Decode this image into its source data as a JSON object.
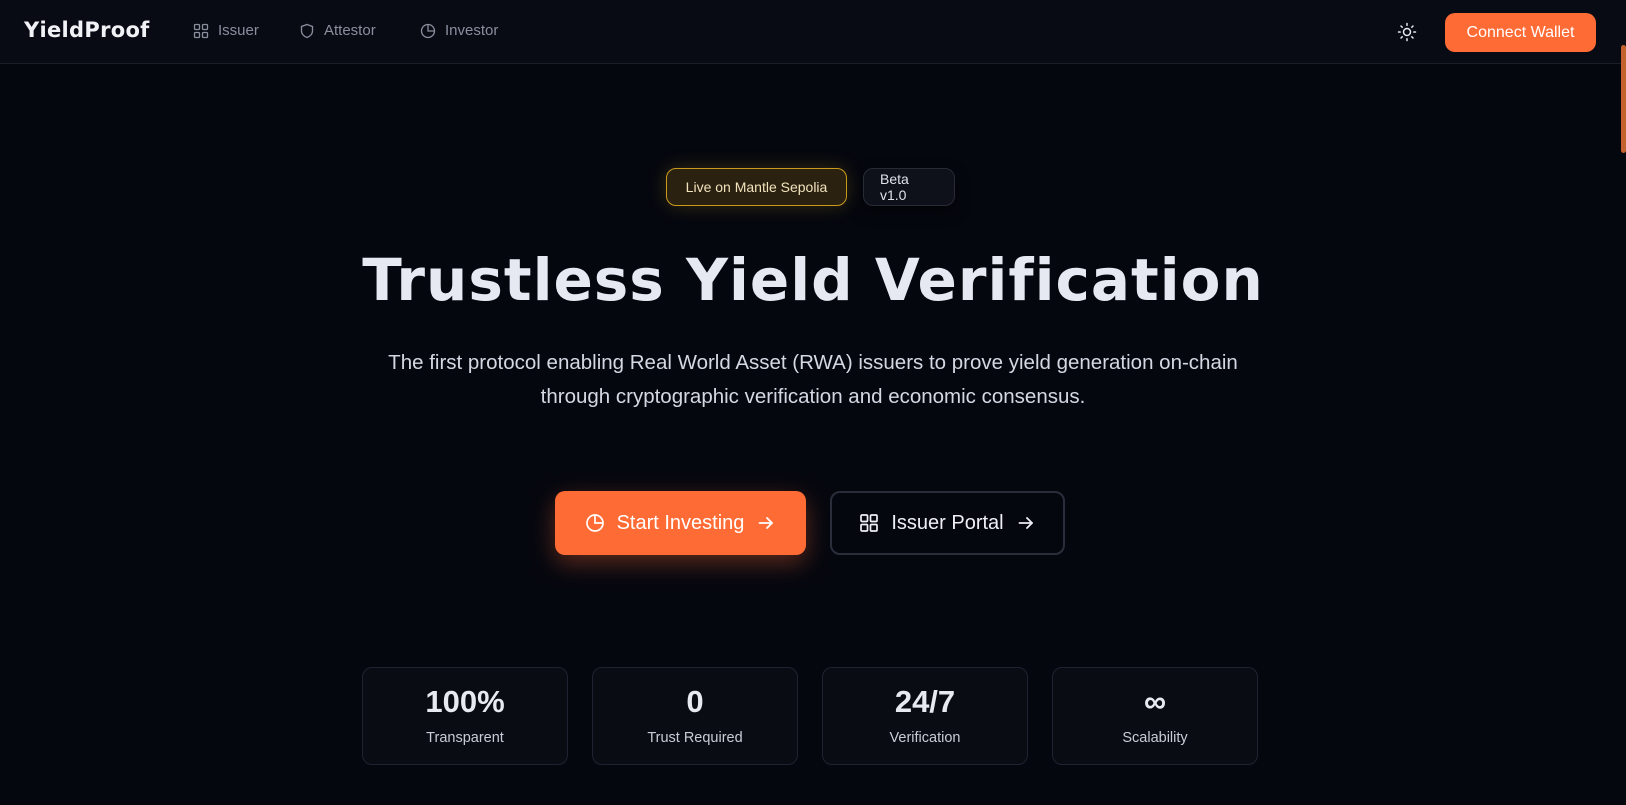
{
  "header": {
    "logo": "YieldProof",
    "nav": [
      {
        "label": "Issuer",
        "icon": "grid-icon"
      },
      {
        "label": "Attestor",
        "icon": "shield-icon"
      },
      {
        "label": "Investor",
        "icon": "pie-chart-icon"
      }
    ],
    "theme_icon": "sun-icon",
    "connect_label": "Connect Wallet"
  },
  "badges": {
    "live": "Live on Mantle Sepolia",
    "beta": "Beta v1.0"
  },
  "hero": {
    "title": "Trustless Yield Verification",
    "subtitle_line1": "The first protocol enabling Real World Asset (RWA) issuers to prove yield generation on-chain",
    "subtitle_line2": "through cryptographic verification and economic consensus."
  },
  "cta": {
    "primary": "Start Investing",
    "secondary": "Issuer Portal"
  },
  "stats": [
    {
      "value": "100%",
      "label": "Transparent"
    },
    {
      "value": "0",
      "label": "Trust Required"
    },
    {
      "value": "24/7",
      "label": "Verification"
    },
    {
      "value": "∞",
      "label": "Scalability"
    }
  ],
  "colors": {
    "accent": "#ff6b35",
    "background": "#05070f",
    "live_badge_border": "#c99a1b"
  }
}
